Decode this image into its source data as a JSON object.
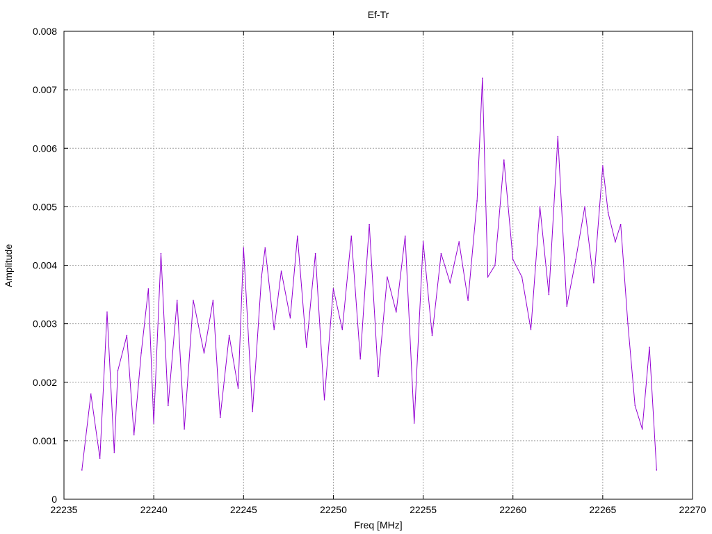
{
  "chart_data": {
    "type": "line",
    "title": "Ef-Tr",
    "xlabel": "Freq [MHz]",
    "ylabel": "Amplitude",
    "xlim": [
      22235,
      22270
    ],
    "ylim": [
      0,
      0.008
    ],
    "x_ticks": [
      "22235",
      "22240",
      "22245",
      "22250",
      "22255",
      "22260",
      "22265",
      "22270"
    ],
    "y_ticks": [
      "0",
      "0.001",
      "0.002",
      "0.003",
      "0.004",
      "0.005",
      "0.006",
      "0.007",
      "0.008"
    ],
    "grid": true,
    "legend": "none",
    "line_color": "#9400d3",
    "series": [
      {
        "x": [
          22236.0,
          22236.5,
          22237.0,
          22237.4,
          22237.8,
          22238.0,
          22238.5,
          22238.9,
          22239.3,
          22239.7,
          22240.0,
          22240.4,
          22240.8,
          22241.3,
          22241.7,
          22242.2,
          22242.8,
          22243.3,
          22243.7,
          22244.2,
          22244.7,
          22245.0,
          22245.5,
          22246.0,
          22246.2,
          22246.7,
          22247.1,
          22247.6,
          22248.0,
          22248.5,
          22249.0,
          22249.5,
          22250.0,
          22250.5,
          22251.0,
          22251.5,
          22252.0,
          22252.5,
          22253.0,
          22253.5,
          22254.0,
          22254.5,
          22255.0,
          22255.5,
          22256.0,
          22256.5,
          22257.0,
          22257.5,
          22258.0,
          22258.3,
          22258.6,
          22259.0,
          22259.5,
          22260.0,
          22260.5,
          22261.0,
          22261.5,
          22262.0,
          22262.5,
          22263.0,
          22263.5,
          22264.0,
          22264.5,
          22265.0,
          22265.3,
          22265.7,
          22266.0,
          22266.4,
          22266.8,
          22267.2,
          22267.6,
          22268.0
        ],
        "y": [
          0.0005,
          0.0018,
          0.0007,
          0.0032,
          0.0008,
          0.0022,
          0.0028,
          0.0011,
          0.0025,
          0.0036,
          0.0013,
          0.0042,
          0.0016,
          0.0034,
          0.0012,
          0.0034,
          0.0025,
          0.0034,
          0.0014,
          0.0028,
          0.0019,
          0.0043,
          0.0015,
          0.0038,
          0.0043,
          0.0029,
          0.0039,
          0.0031,
          0.0045,
          0.0026,
          0.0042,
          0.0017,
          0.0036,
          0.0029,
          0.0045,
          0.0024,
          0.0047,
          0.0021,
          0.0038,
          0.0032,
          0.0045,
          0.0013,
          0.0044,
          0.0028,
          0.0042,
          0.0037,
          0.0044,
          0.0034,
          0.0051,
          0.0072,
          0.0038,
          0.004,
          0.0058,
          0.0041,
          0.0038,
          0.0029,
          0.005,
          0.0035,
          0.0062,
          0.0033,
          0.0041,
          0.005,
          0.0037,
          0.0057,
          0.0049,
          0.0044,
          0.0047,
          0.003,
          0.0016,
          0.0012,
          0.0026,
          0.0005
        ]
      }
    ]
  }
}
